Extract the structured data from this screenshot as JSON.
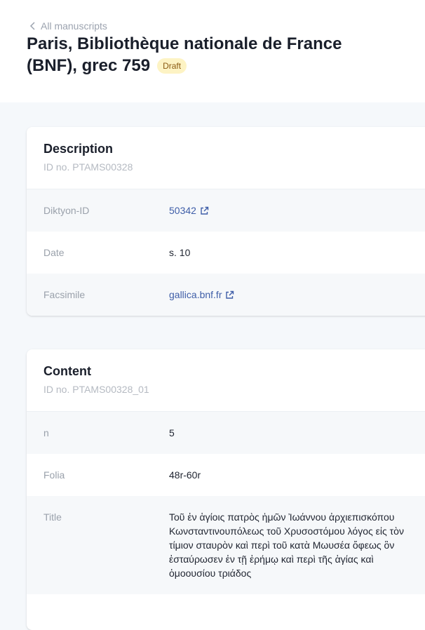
{
  "header": {
    "back_label": "All manuscripts",
    "title": "Paris, Bibliothèque nationale de France (BNF), grec 759",
    "badge": "Draft"
  },
  "description": {
    "title": "Description",
    "id_line": "ID no. PTAMS00328",
    "rows": [
      {
        "label": "Diktyon-ID",
        "value": "50342"
      },
      {
        "label": "Date",
        "value": "s. 10"
      },
      {
        "label": "Facsimile",
        "value": "gallica.bnf.fr"
      }
    ]
  },
  "content": {
    "title": "Content",
    "id_line": "ID no. PTAMS00328_01",
    "rows": [
      {
        "label": "n",
        "value": "5"
      },
      {
        "label": "Folia",
        "value": "48r-60r"
      },
      {
        "label": "Title",
        "value": "Τοῦ ἐν ἁγίοις πατρὸς ἡμῶν Ἰωάννου ἀρχιεπισκόπου Κωνσταντινουπόλεως τοῦ Χρυσοστόμου λόγος εἰς τὸν τίμιον σταυρὸν καὶ περὶ τοῦ κατὰ Μωυσέα ὄφεως ὃν ἐσταύρωσεν ἐν τῇ ἐρήμῳ καὶ περὶ τῆς ἁγίας καὶ ὁμοουσίου τριάδος"
      }
    ]
  },
  "colors": {
    "link": "#3f5ea8",
    "badge_bg": "#fdf3c4",
    "badge_text": "#8a5a12",
    "page_bg": "#f5f8fb"
  }
}
